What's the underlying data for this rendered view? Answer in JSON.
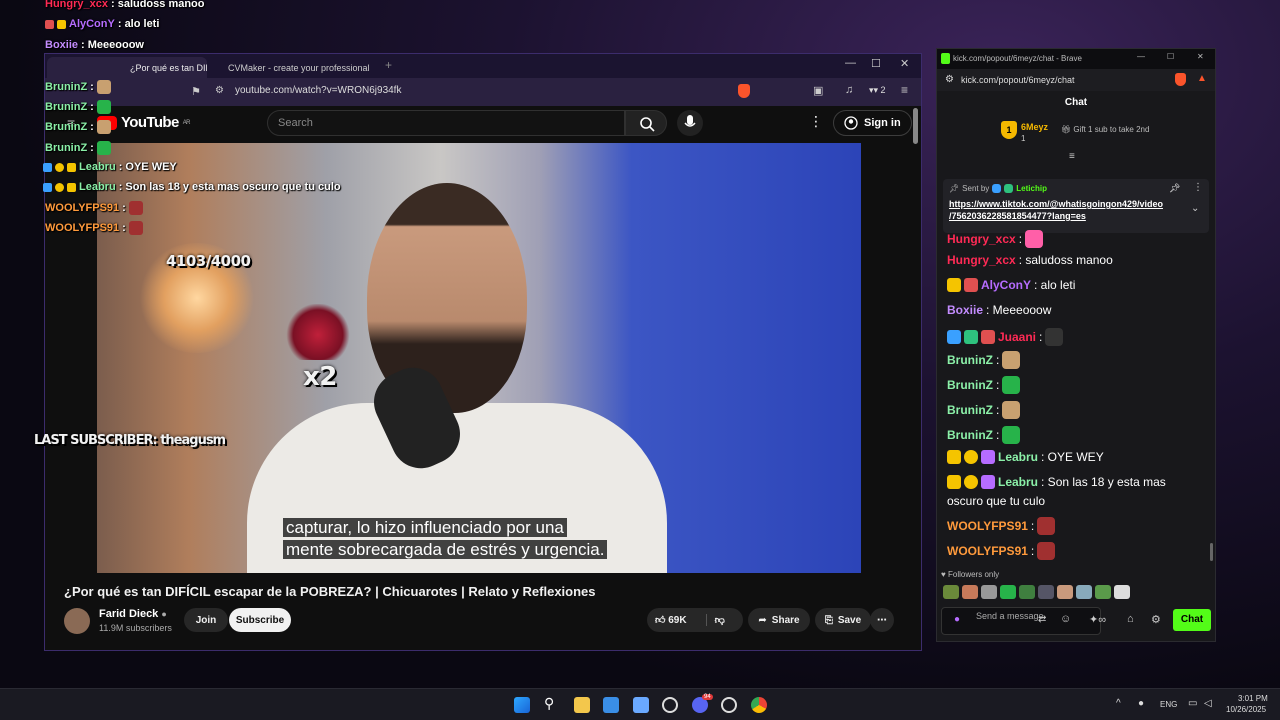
{
  "overlay": {
    "chat_lines": [
      {
        "user": "Hungry_xcx",
        "text": ": saludoss manoo",
        "color": "#ff2a55"
      },
      {
        "user": "AlyConY",
        "text": ": alo leti",
        "color": "#b66cff"
      },
      {
        "user": "Boxiie",
        "text": ": Meeeooow",
        "color": "#c38cff"
      },
      {
        "user": "BruninZ",
        "text": ":",
        "color": "#8bf0a8"
      },
      {
        "user": "BruninZ",
        "text": ":",
        "color": "#8bf0a8"
      },
      {
        "user": "BruninZ",
        "text": ":",
        "color": "#8bf0a8"
      },
      {
        "user": "BruninZ",
        "text": ":",
        "color": "#8bf0a8"
      },
      {
        "user": "Leabru",
        "text": ": OYE WEY",
        "color": "#8bf0a8"
      },
      {
        "user": "Leabru",
        "text": ": Son las 18 y esta mas oscuro que tu culo",
        "color": "#8bf0a8"
      },
      {
        "user": "WOOLYFPS91",
        "text": ":",
        "color": "#ff9a3c"
      },
      {
        "user": "WOOLYFPS91",
        "text": ":",
        "color": "#ff9a3c"
      }
    ],
    "sub_goal": "4103/4000",
    "multiplier": "x2",
    "last_subscriber": "LAST SUBSCRIBER: theagusm"
  },
  "youtube": {
    "tabs": [
      {
        "label": "¿Por qué es tan DIFÍCIL escap",
        "icon": "youtube-icon"
      },
      {
        "label": "CVMaker - create your professional",
        "icon": "cvmaker-icon"
      }
    ],
    "new_tab": "+",
    "url": "youtube.com/watch?v=WRON6j934fk",
    "extension_count": "2",
    "logo": "YouTube",
    "logo_region": "AR",
    "search_placeholder": "Search",
    "sign_in": "Sign in",
    "caption_lines": [
      "capturar, lo hizo influenciado por una",
      "mente sobrecargada de estrés y urgencia."
    ],
    "video_title": "¿Por qué es tan DIFÍCIL escapar de la POBREZA? | Chicuarotes | Relato y Reflexiones",
    "channel": "Farid Dieck",
    "subscribers": "11.9M subscribers",
    "join": "Join",
    "subscribe": "Subscribe",
    "likes": "69K",
    "share": "Share",
    "save": "Save"
  },
  "kick": {
    "window_title": "kick.com/popout/6meyz/chat - Brave",
    "url": "kick.com/popout/6meyz/chat",
    "header": "Chat",
    "leader_name": "6Meyz",
    "leader_count": "1",
    "gift_text": "Gift 1 sub to take 2nd",
    "pinned_sent_by": "Sent by",
    "pinned_user": "Letichip",
    "pinned_link": [
      "https://www.tiktok.com/@whatisgoingon429/video",
      "/7562036228581854477?lang=es"
    ],
    "messages": [
      {
        "user": "Hungry_xcx",
        "text": ":",
        "color": "#ff2a55"
      },
      {
        "user": "Hungry_xcx",
        "text": ": saludoss manoo",
        "color": "#ff2a55"
      },
      {
        "user": "AlyConY",
        "text": ": alo leti",
        "color": "#b66cff"
      },
      {
        "user": "Boxiie",
        "text": ": Meeeooow",
        "color": "#c38cff"
      },
      {
        "user": "Juaani",
        "text": ":",
        "color": "#ff2a55"
      },
      {
        "user": "BruninZ",
        "text": ":",
        "color": "#8bf0a8"
      },
      {
        "user": "BruninZ",
        "text": ":",
        "color": "#8bf0a8"
      },
      {
        "user": "BruninZ",
        "text": ":",
        "color": "#8bf0a8"
      },
      {
        "user": "BruninZ",
        "text": ":",
        "color": "#8bf0a8"
      },
      {
        "user": "Leabru",
        "text": ": OYE WEY",
        "color": "#8bf0a8"
      },
      {
        "user": "Leabru",
        "text": ": Son las 18 y esta mas",
        "color": "#8bf0a8"
      },
      {
        "user": "",
        "text": "oscuro que tu culo",
        "color": "#8bf0a8"
      },
      {
        "user": "WOOLYFPS91",
        "text": ":",
        "color": "#ff9a3c"
      },
      {
        "user": "WOOLYFPS91",
        "text": ":",
        "color": "#ff9a3c"
      }
    ],
    "followers_only": "Followers only",
    "send_placeholder": "Send a message",
    "chat_button": "Chat"
  },
  "taskbar": {
    "lang": "ENG",
    "time": "3:01 PM",
    "date": "10/26/2025",
    "discord_badge": "94"
  }
}
